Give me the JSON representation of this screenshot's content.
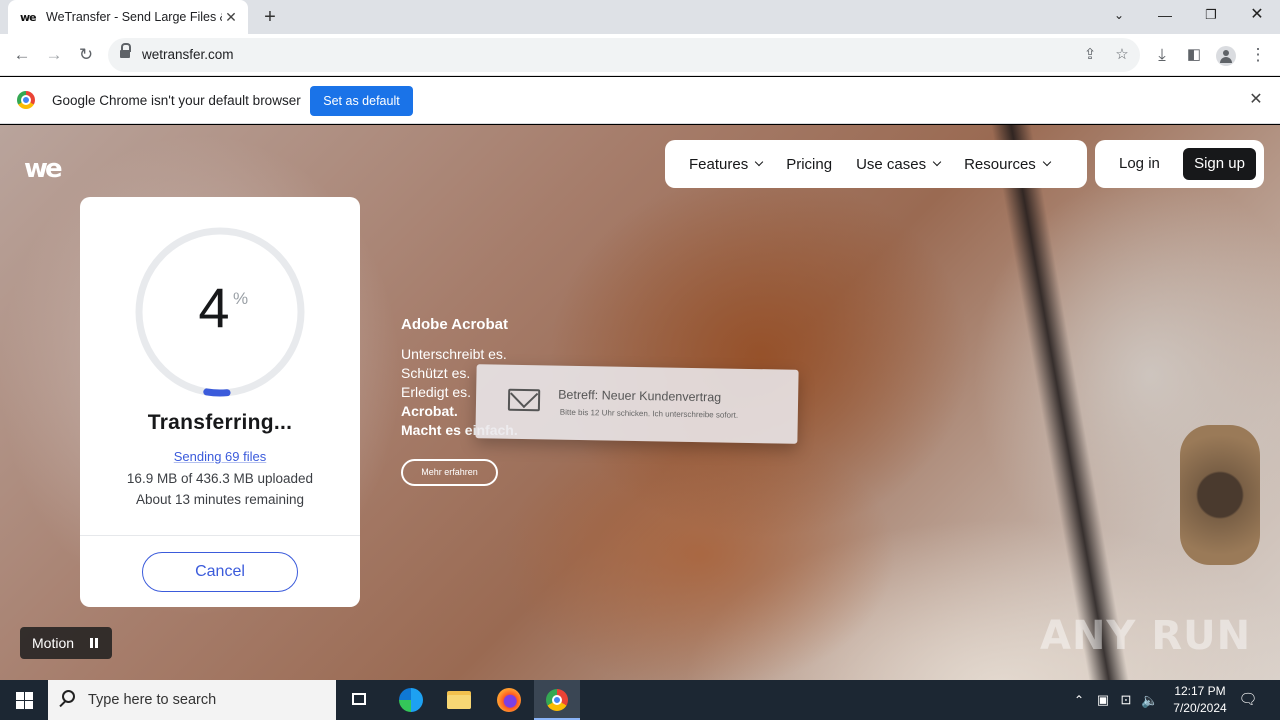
{
  "browser": {
    "tab_title": "WeTransfer - Send Large Files &",
    "tab_favicon": "we",
    "new_tab_label": "+",
    "url": "wetransfer.com"
  },
  "infobar": {
    "message": "Google Chrome isn't your default browser",
    "button_label": "Set as default"
  },
  "site": {
    "logo": "we",
    "nav": [
      {
        "label": "Features",
        "has_dropdown": true
      },
      {
        "label": "Pricing",
        "has_dropdown": false
      },
      {
        "label": "Use cases",
        "has_dropdown": true
      },
      {
        "label": "Resources",
        "has_dropdown": true
      }
    ],
    "login_label": "Log in",
    "signup_label": "Sign up"
  },
  "transfer": {
    "progress_value": "4",
    "progress_fraction": 0.04,
    "progress_unit": "%",
    "status": "Transferring...",
    "sending_link": "Sending 69 files",
    "uploaded": "16.9 MB of 436.3 MB uploaded",
    "remaining": "About 13 minutes remaining",
    "cancel_label": "Cancel"
  },
  "ad": {
    "brand": "Adobe Acrobat",
    "lines": [
      "Unterschreibt es.",
      "Schützt es.",
      "Erledigt es.",
      "Acrobat.",
      "Macht es einfach."
    ],
    "button_label": "Mehr erfahren",
    "mail_subject": "Betreff: Neuer Kundenvertrag",
    "mail_body": "Bitte bis 12 Uhr schicken. Ich unterschreibe sofort."
  },
  "motion": {
    "label": "Motion"
  },
  "watermark": "ANY RUN",
  "taskbar": {
    "search_placeholder": "Type here to search",
    "time": "12:17 PM",
    "date": "7/20/2024"
  },
  "colors": {
    "accent_blue": "#3b5bdb",
    "chrome_blue": "#1a73e8",
    "ring_track": "#e8eaed",
    "dark": "#17181a"
  }
}
